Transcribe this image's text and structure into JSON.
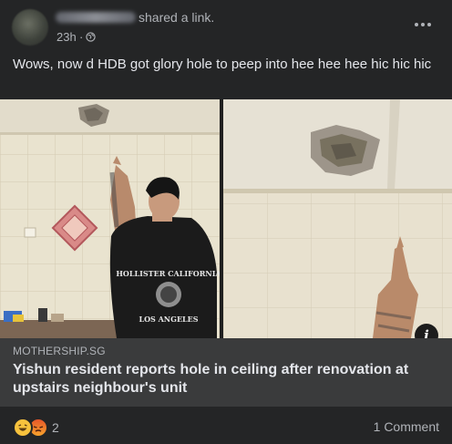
{
  "post": {
    "action_text": "shared a link.",
    "time": "23h",
    "separator": "·",
    "privacy_icon": "globe-icon",
    "menu_icon": "more-options-icon",
    "caption": "Wows, now d HDB got glory hole to peep into hee hee hee hic hic hic"
  },
  "link_preview": {
    "domain": "MOTHERSHIP.SG",
    "title": "Yishun resident reports hole in ceiling after renovation at upstairs neighbour's unit",
    "info_icon": "i"
  },
  "engagement": {
    "reaction_icons": [
      "haha-icon",
      "angry-icon"
    ],
    "reaction_count": "2",
    "comments": "1 Comment"
  },
  "shirt": {
    "line1": "HOLLISTER CALIFORNIA",
    "line2": "LOS ANGELES"
  }
}
